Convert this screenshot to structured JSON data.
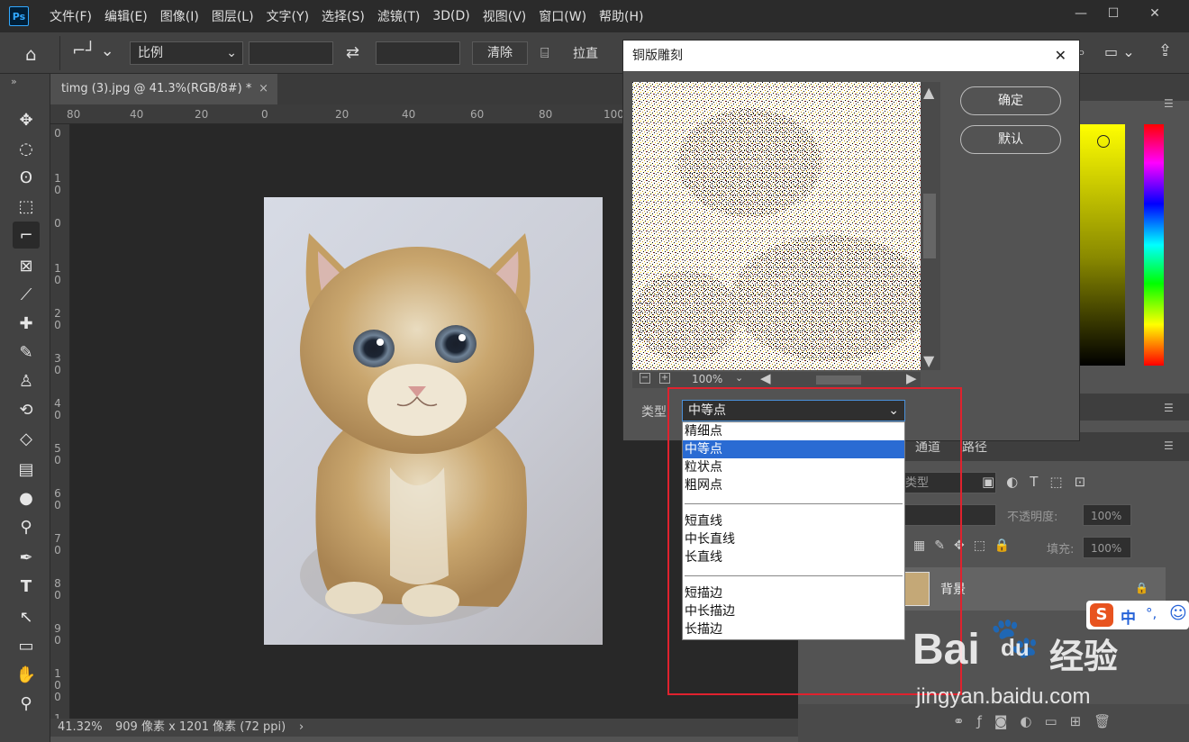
{
  "app": {
    "logo": "Ps"
  },
  "menu": [
    "文件(F)",
    "编辑(E)",
    "图像(I)",
    "图层(L)",
    "文字(Y)",
    "选择(S)",
    "滤镜(T)",
    "3D(D)",
    "视图(V)",
    "窗口(W)",
    "帮助(H)"
  ],
  "window_controls": {
    "minimize": "—",
    "restore": "☐",
    "close": "✕"
  },
  "options": {
    "ratio_label": "比例",
    "clear_label": "清除",
    "straighten_label": "拉直"
  },
  "document": {
    "tab_title": "timg (3).jpg @ 41.3%(RGB/8#) *",
    "close_glyph": "×"
  },
  "ruler": {
    "h_labels": [
      "80",
      "40",
      "20",
      "0",
      "20",
      "40",
      "60",
      "80",
      "100"
    ],
    "v_labels": [
      "0",
      "1 0",
      "0",
      "1 0",
      "2 0",
      "3 0",
      "4 0",
      "5 0",
      "6 0",
      "7 0",
      "8 0",
      "9 0",
      "1 0 0",
      "1 1"
    ]
  },
  "status": {
    "zoom": "41.32%",
    "dimensions": "909 像素 x 1201 像素 (72 ppi)",
    "arrow": "›"
  },
  "dialog": {
    "title": "铜版雕刻",
    "close": "✕",
    "ok_label": "确定",
    "default_label": "默认",
    "zoom": "100%",
    "type_label": "类型",
    "type_value": "中等点"
  },
  "dropdown_options": [
    {
      "label": "精细点",
      "selected": false
    },
    {
      "label": "中等点",
      "selected": true
    },
    {
      "label": "粒状点",
      "selected": false
    },
    {
      "label": "粗网点",
      "selected": false
    },
    {
      "label": "短直线",
      "selected": false
    },
    {
      "label": "中长直线",
      "selected": false
    },
    {
      "label": "长直线",
      "selected": false
    },
    {
      "label": "短描边",
      "selected": false
    },
    {
      "label": "中长描边",
      "selected": false
    },
    {
      "label": "长描边",
      "selected": false
    }
  ],
  "layers_panel": {
    "tab_channels": "通道",
    "tab_paths": "路径",
    "kind_label": "类型",
    "opacity_label": "不透明度:",
    "opacity_value": "100%",
    "fill_label": "填充:",
    "fill_value": "100%",
    "layer_name": "背景"
  },
  "ime": {
    "logo": "S",
    "mode": "中",
    "punct": "°,",
    "emoji": "☺"
  },
  "watermark": {
    "brand": "Bai",
    "brand2": "du",
    "cn": "经验",
    "url": "jingyan.baidu.com"
  },
  "colors": {
    "accent": "#2a6bd3",
    "highlight_box": "#e0222e",
    "bg": "#535353"
  }
}
